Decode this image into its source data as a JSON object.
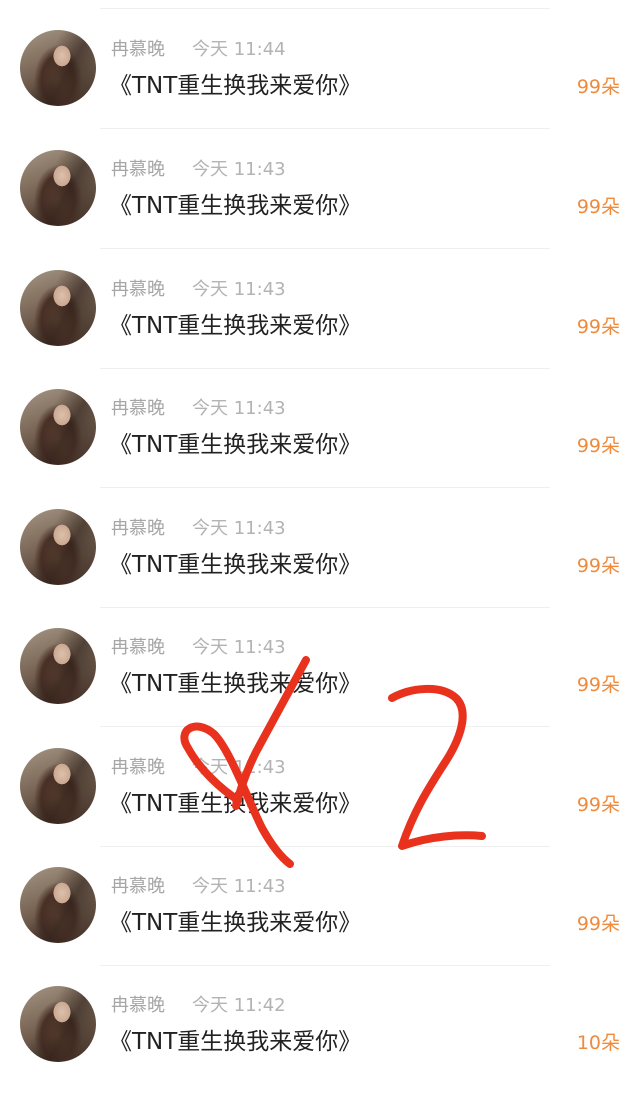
{
  "records": [
    {
      "name": "冉慕晚",
      "time": "今天 11:44",
      "title": "《TNT重生换我来爱你》",
      "amount": "99朵"
    },
    {
      "name": "冉慕晚",
      "time": "今天 11:43",
      "title": "《TNT重生换我来爱你》",
      "amount": "99朵"
    },
    {
      "name": "冉慕晚",
      "time": "今天 11:43",
      "title": "《TNT重生换我来爱你》",
      "amount": "99朵"
    },
    {
      "name": "冉慕晚",
      "time": "今天 11:43",
      "title": "《TNT重生换我来爱你》",
      "amount": "99朵"
    },
    {
      "name": "冉慕晚",
      "time": "今天 11:43",
      "title": "《TNT重生换我来爱你》",
      "amount": "99朵"
    },
    {
      "name": "冉慕晚",
      "time": "今天 11:43",
      "title": "《TNT重生换我来爱你》",
      "amount": "99朵"
    },
    {
      "name": "冉慕晚",
      "time": "今天 11:43",
      "title": "《TNT重生换我来爱你》",
      "amount": "99朵"
    },
    {
      "name": "冉慕晚",
      "time": "今天 11:43",
      "title": "《TNT重生换我来爱你》",
      "amount": "99朵"
    },
    {
      "name": "冉慕晚",
      "time": "今天 11:42",
      "title": "《TNT重生换我来爱你》",
      "amount": "10朵"
    }
  ],
  "colors": {
    "amount": "#f08a3c",
    "annotation": "#e8321e"
  }
}
